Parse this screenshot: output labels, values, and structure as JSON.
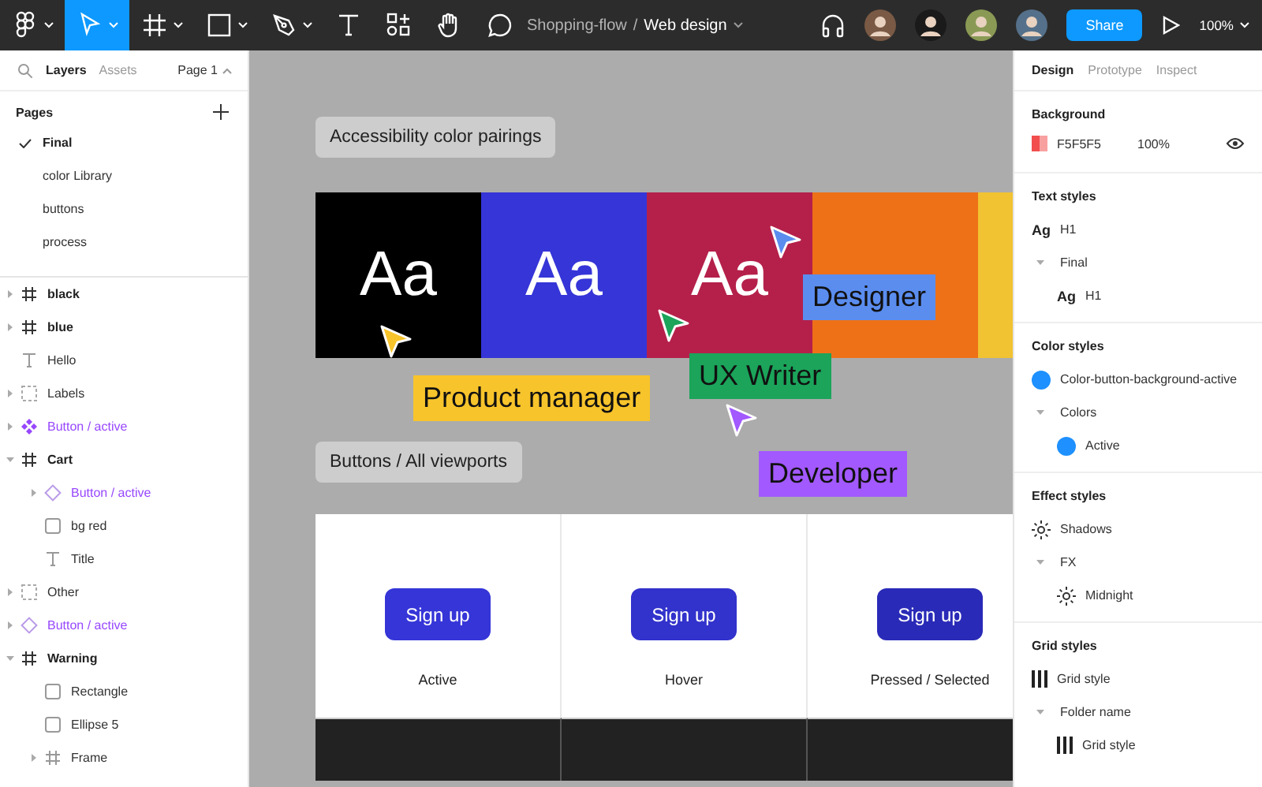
{
  "toolbar": {
    "tools": [
      {
        "kind": "logo",
        "caret": true,
        "selected": false
      },
      {
        "kind": "move",
        "caret": true,
        "selected": true
      },
      {
        "kind": "frame",
        "caret": true,
        "selected": false
      },
      {
        "kind": "shape",
        "caret": true,
        "selected": false
      },
      {
        "kind": "pen",
        "caret": true,
        "selected": false
      },
      {
        "kind": "text",
        "caret": false,
        "selected": false
      },
      {
        "kind": "resources",
        "caret": false,
        "selected": false
      },
      {
        "kind": "hand",
        "caret": false,
        "selected": false
      },
      {
        "kind": "comment",
        "caret": false,
        "selected": false
      }
    ],
    "project": "Shopping-flow",
    "separator": "/",
    "file": "Web design",
    "avatars": [
      {
        "color": "#7a5a45"
      },
      {
        "color": "#1a1a1a"
      },
      {
        "color": "#8a9a55"
      },
      {
        "color": "#55708a"
      }
    ],
    "share": "Share",
    "zoom": "100%"
  },
  "left_panel": {
    "tabs": [
      {
        "label": "Layers",
        "selected": true
      },
      {
        "label": "Assets",
        "selected": false
      }
    ],
    "page_picker": "Page 1",
    "pages_title": "Pages",
    "pages": [
      {
        "label": "Final",
        "selected": true
      },
      {
        "label": "color Library",
        "selected": false
      },
      {
        "label": "buttons",
        "selected": false
      },
      {
        "label": "process",
        "selected": false
      }
    ],
    "layers": [
      {
        "kind": "frame",
        "label": "black",
        "expanded": false
      },
      {
        "kind": "frame",
        "label": "blue",
        "expanded": false
      },
      {
        "kind": "text",
        "label": "Hello"
      },
      {
        "kind": "group",
        "label": "Labels",
        "expanded": false
      },
      {
        "kind": "component",
        "label": "Button / active",
        "expanded": false
      },
      {
        "kind": "frame",
        "label": "Cart",
        "expanded": true,
        "children": [
          {
            "kind": "instance",
            "label": "Button / active",
            "expanded": false
          },
          {
            "kind": "rect",
            "label": "bg red"
          },
          {
            "kind": "text",
            "label": "Title"
          }
        ]
      },
      {
        "kind": "group",
        "label": "Other",
        "expanded": false
      },
      {
        "kind": "instance",
        "label": "Button / active",
        "expanded": false
      },
      {
        "kind": "frame",
        "label": "Warning",
        "expanded": true,
        "children": [
          {
            "kind": "rect",
            "label": "Rectangle"
          },
          {
            "kind": "rect",
            "label": "Ellipse 5"
          },
          {
            "kind": "frame",
            "label": "Frame",
            "expanded": false
          }
        ]
      }
    ]
  },
  "canvas": {
    "title_1": "Accessibility color pairings",
    "swatches": [
      {
        "color": "#000000",
        "sample": "Aa"
      },
      {
        "color": "#3535d8",
        "sample": "Aa"
      },
      {
        "color": "#b5204a",
        "sample": "Aa"
      },
      {
        "color": "#ee7118"
      },
      {
        "color": "#f1c232"
      }
    ],
    "title_2": "Buttons / All viewports",
    "button_states": [
      {
        "button": "Sign up",
        "label": "Active",
        "color": "#3535d8"
      },
      {
        "button": "Sign up",
        "label": "Hover",
        "color": "#3232cc"
      },
      {
        "button": "Sign up",
        "label": "Pressed / Selected",
        "color": "#2a2ab8"
      }
    ],
    "cursors": [
      {
        "name": "Designer",
        "color": "#5b8def"
      },
      {
        "name": "Product manager",
        "color": "#f8c42b"
      },
      {
        "name": "UX Writer",
        "color": "#1ba45a"
      },
      {
        "name": "Developer",
        "color": "#a259ff"
      }
    ]
  },
  "right_panel": {
    "tabs": [
      {
        "label": "Design",
        "selected": true
      },
      {
        "label": "Prototype",
        "selected": false
      },
      {
        "label": "Inspect",
        "selected": false
      }
    ],
    "background": {
      "title": "Background",
      "hex": "F5F5F5",
      "opacity": "100%"
    },
    "sections": [
      {
        "title": "Text styles",
        "items": [
          {
            "kind": "text",
            "sample": "Ag",
            "label": "H1"
          },
          {
            "kind": "folder",
            "label": "Final",
            "children": [
              {
                "kind": "text",
                "sample": "Ag",
                "label": "H1"
              }
            ]
          }
        ]
      },
      {
        "title": "Color styles",
        "items": [
          {
            "kind": "color",
            "color": "#1e90ff",
            "label": "Color-button-background-active"
          },
          {
            "kind": "folder",
            "label": "Colors",
            "children": [
              {
                "kind": "color",
                "color": "#1e90ff",
                "label": "Active"
              }
            ]
          }
        ]
      },
      {
        "title": "Effect styles",
        "items": [
          {
            "kind": "effect",
            "label": "Shadows"
          },
          {
            "kind": "folder",
            "label": "FX",
            "children": [
              {
                "kind": "effect",
                "label": "Midnight"
              }
            ]
          }
        ]
      },
      {
        "title": "Grid styles",
        "items": [
          {
            "kind": "grid",
            "label": "Grid style"
          },
          {
            "kind": "folder",
            "label": "Folder name",
            "children": [
              {
                "kind": "grid",
                "label": "Grid style"
              }
            ]
          }
        ]
      }
    ]
  }
}
